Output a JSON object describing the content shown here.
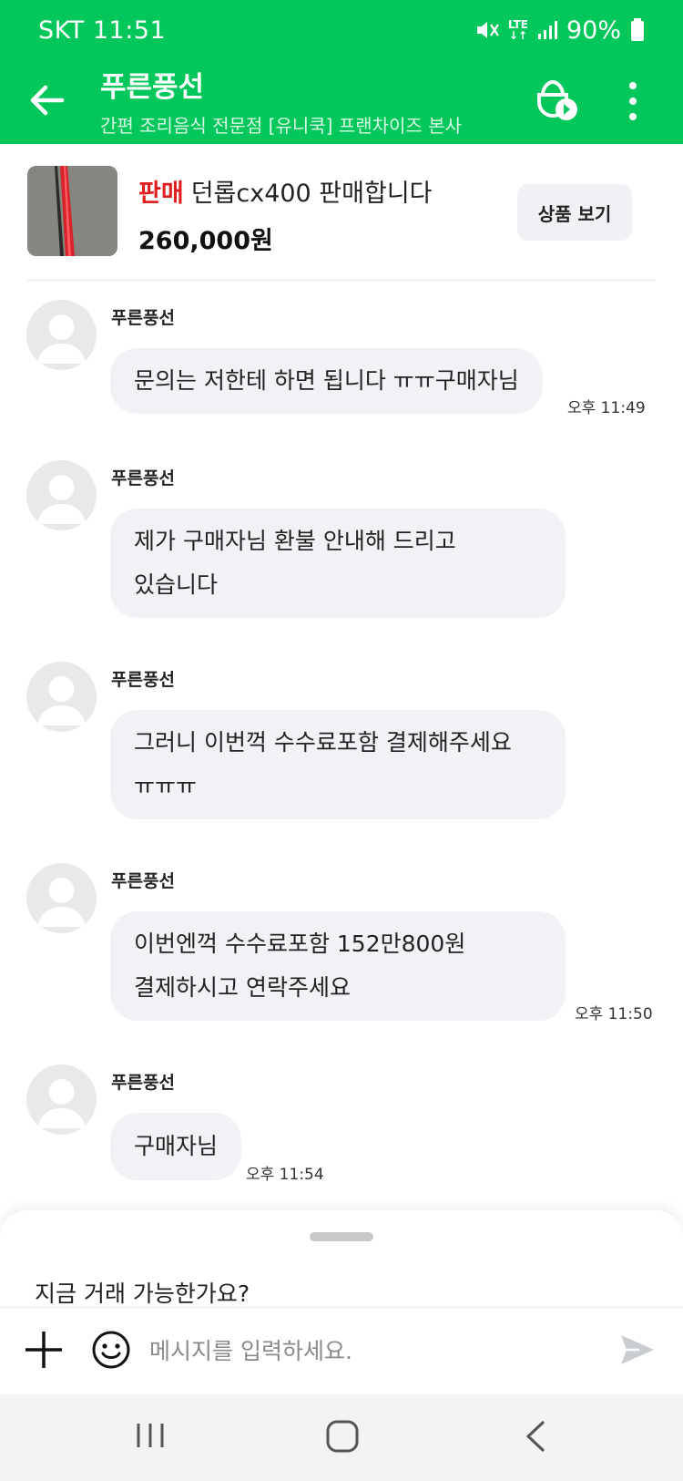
{
  "status_bar": {
    "carrier": "SKT",
    "time": "11:51",
    "network": "LTE",
    "battery": "90%"
  },
  "header": {
    "title": "푸른풍선",
    "subtitle": "간편 조리음식 전문점 [유니쿡] 프랜차이즈 본사",
    "icons": [
      "back-arrow-icon",
      "promise-icon",
      "more-vertical-icon"
    ],
    "accent_color": "#03c75a"
  },
  "product": {
    "status_label": "판매",
    "name": "던롭cx400 판매합니다",
    "price": "260,000원",
    "view_button": "상품 보기"
  },
  "messages": [
    {
      "sender": "푸른풍선",
      "lines": [
        "문의는 저한테 하면 됩니다 ㅠㅠ구매자님"
      ],
      "time": "오후 11:49"
    },
    {
      "sender": "푸른풍선",
      "lines": [
        "제가 구매자님 환불 안내해 드리고",
        "있습니다"
      ],
      "time": ""
    },
    {
      "sender": "푸른풍선",
      "lines": [
        "그러니 이번꺽 수수료포함 결제해주세요",
        "ㅠㅠㅠ"
      ],
      "time": ""
    },
    {
      "sender": "푸른풍선",
      "lines": [
        "이번엔꺽 수수료포함 152만800원",
        "결제하시고 연락주세요"
      ],
      "time": "오후 11:50"
    },
    {
      "sender": "푸른풍선",
      "lines": [
        "구매자님"
      ],
      "time": "오후 11:54"
    }
  ],
  "quick_reply": "지금 거래 가능한가요?",
  "input": {
    "placeholder": "메시지를 입력하세요."
  }
}
